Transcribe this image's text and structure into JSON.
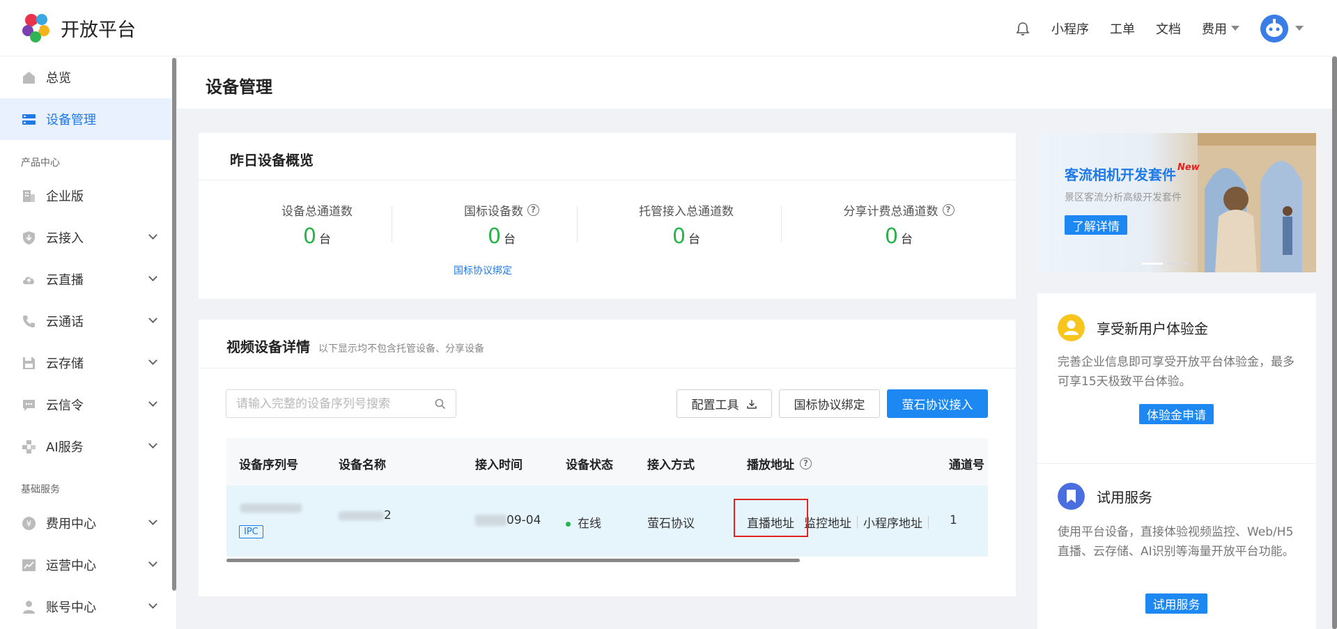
{
  "header": {
    "logo_text": "开放平台",
    "nav": [
      "小程序",
      "工单",
      "文档"
    ],
    "fee_label": "费用"
  },
  "sidebar": {
    "overview": "总览",
    "device_mgmt": "设备管理",
    "section_products": "产品中心",
    "enterprise": "企业版",
    "cloud_access": "云接入",
    "cloud_live": "云直播",
    "cloud_call": "云通话",
    "cloud_storage": "云存储",
    "cloud_signal": "云信令",
    "ai_service": "AI服务",
    "section_basic": "基础服务",
    "fee_center": "费用中心",
    "ops_center": "运营中心",
    "account_center": "账号中心"
  },
  "page": {
    "title": "设备管理"
  },
  "overview_card": {
    "title": "昨日设备概览",
    "stats": [
      {
        "label": "设备总通道数",
        "value": "0",
        "unit": "台"
      },
      {
        "label": "国标设备数",
        "value": "0",
        "unit": "台"
      },
      {
        "label": "托管接入总通道数",
        "value": "0",
        "unit": "台"
      },
      {
        "label": "分享计费总通道数",
        "value": "0",
        "unit": "台"
      }
    ],
    "gb_bind_link": "国标协议绑定"
  },
  "device_card": {
    "title": "视频设备详情",
    "subtitle": "以下显示均不包含托管设备、分享设备",
    "search_placeholder": "请输入完整的设备序列号搜索",
    "btn_config_tool": "配置工具",
    "btn_gb_bind": "国标协议绑定",
    "btn_ezviz_access": "萤石协议接入",
    "columns": [
      "设备序列号",
      "设备名称",
      "接入时间",
      "设备状态",
      "接入方式",
      "播放地址",
      "通道号"
    ],
    "row": {
      "serial_tag": "IPC",
      "name_suffix": "2",
      "time_partial": "09-04",
      "status": "在线",
      "access_mode": "萤石协议",
      "play_live": "直播地址",
      "play_monitor": "监控地址",
      "play_miniprogram": "小程序地址",
      "channel": "1"
    }
  },
  "banner": {
    "title": "客流相机开发套件",
    "badge": "New",
    "subtitle": "景区客流分析高级开发套件",
    "button": "了解详情"
  },
  "promo_trial_credit": {
    "title": "享受新用户体验金",
    "desc": "完善企业信息即可享受开放平台体验金，最多可享15天极致平台体验。",
    "button": "体验金申请"
  },
  "promo_trial_service": {
    "title": "试用服务",
    "desc": "使用平台设备，直接体验视频监控、Web/H5直播、云存储、AI识别等海量开放平台功能。",
    "button": "试用服务"
  },
  "colors": {
    "accent": "#1e88f2",
    "success": "#29b34b",
    "highlight": "#e02222"
  }
}
